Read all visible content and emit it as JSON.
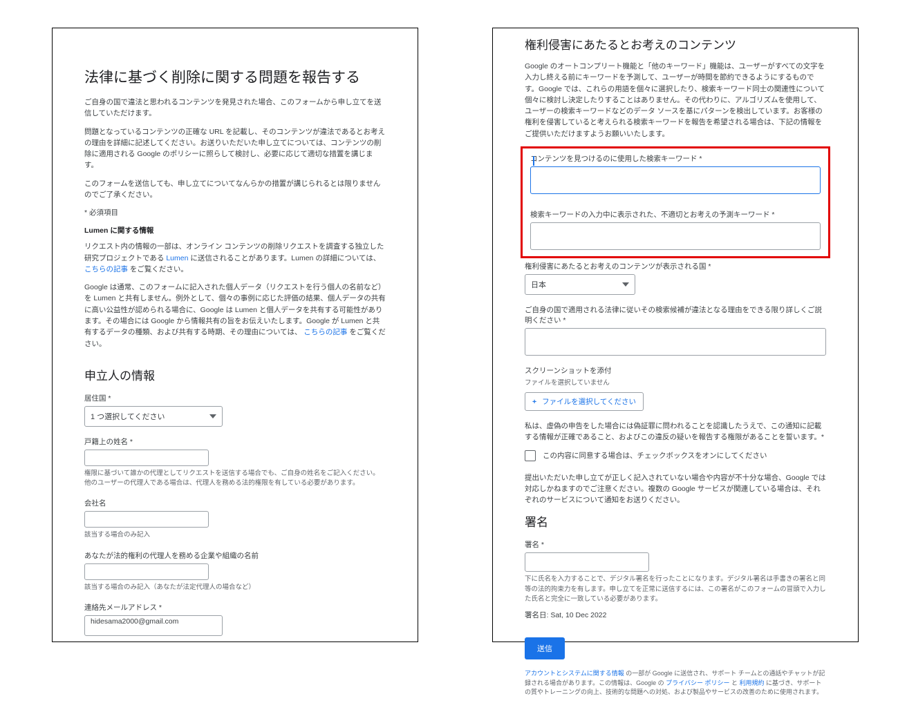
{
  "left": {
    "title": "法律に基づく削除に関する問題を報告する",
    "intro1": "ご自身の国で違法と思われるコンテンツを発見された場合、このフォームから申し立てを送信していただけます。",
    "intro2": "問題となっているコンテンツの正確な URL を記載し、そのコンテンツが違法であるとお考えの理由を詳細に記述してください。お送りいただいた申し立てについては、コンテンツの削除に適用される Google のポリシーに照らして検討し、必要に応じて適切な措置を講じます。",
    "intro3": "このフォームを送信しても、申し立てについてなんらかの措置が講じられるとは限りませんのでご了承ください。",
    "required_note": "* 必須項目",
    "lumen_heading": "Lumen に関する情報",
    "lumen1_a": "リクエスト内の情報の一部は、オンライン コンテンツの削除リクエストを調査する独立した研究プロジェクトである ",
    "lumen1_link": "Lumen",
    "lumen1_b": " に送信されることがあります。Lumen の詳細については、",
    "lumen1_link2": "こちらの記事",
    "lumen1_c": "をご覧ください。",
    "lumen2_a": "Google は通常、このフォームに記入された個人データ（リクエストを行う個人の名前など）を Lumen と共有しません。例外として、個々の事例に応じた評価の結果、個人データの共有に高い公益性が認められる場合に、Google は Lumen と個人データを共有する可能性があります。その場合には Google から情報共有の旨をお伝えいたします。Google が Lumen と共有するデータの種類、および共有する時期、その理由については、",
    "lumen2_link": "こちらの記事",
    "lumen2_b": "をご覧ください。",
    "section_applicant": "申立人の情報",
    "country_label": "居住国 *",
    "country_select": "1 つ選択してください",
    "legalname_label": "戸籍上の姓名 *",
    "legalname_hint": "権限に基づいて誰かの代理としてリクエストを送信する場合でも、ご自身の姓名をご記入ください。他のユーザーの代理人である場合は、代理人を務める法的権限を有している必要があります。",
    "company_label": "会社名",
    "company_hint": "該当する場合のみ記入",
    "agent_label": "あなたが法的権利の代理人を務める企業や組織の名前",
    "agent_hint": "該当する場合のみ記入（あなたが法定代理人の場合など）",
    "email_label": "連絡先メールアドレス *",
    "email_value": "hidesama2000@gmail.com"
  },
  "right": {
    "section_content": "権利侵害にあたるとお考えのコンテンツ",
    "autocomplete_desc": "Google のオートコンプリート機能と「他のキーワード」機能は、ユーザーがすべての文字を入力し終える前にキーワードを予測して、ユーザーが時間を節約できるようにするものです。Google では、これらの用語を個々に選択したり、検索キーワード同士の関連性について個々に検討し決定したりすることはありません。その代わりに、アルゴリズムを使用して、ユーザーの検索キーワードなどのデータ ソースを基にパターンを検出しています。お客様の権利を侵害していると考えられる検索キーワードを報告を希望される場合は、下記の情報をご提供いただけますようお願いいたします。",
    "kw_used_label": "コンテンツを見つけるのに使用した検索キーワード *",
    "kw_pred_label": "検索キーワードの入力中に表示された、不適切とお考えの予測キーワード *",
    "display_country_label": "権利侵害にあたるとお考えのコンテンツが表示される国 *",
    "display_country_value": "日本",
    "reason_label": "ご自身の国で適用される法律に従いその検索候補が違法となる理由をできる限り詳しくご説明ください *",
    "screenshot_label": "スクリーンショットを添付",
    "file_none": "ファイルを選択していません",
    "file_btn": "ファイルを選択してください",
    "ack_text": "私は、虚偽の申告をした場合には偽証罪に問われることを認識したうえで、この通知に記載する情報が正確であること、およびこの違反の疑いを報告する権限があることを誓います。*",
    "checkbox_text": "この内容に同意する場合は、チェックボックスをオンにしてください",
    "submit_note": "提出いただいた申し立てが正しく記入されていない場合や内容が不十分な場合、Google では対応しかねますのでご注意ください。複数の Google サービスが関連している場合は、それぞれのサービスについて通知をお送りください。",
    "sign_section": "署名",
    "sign_label": "署名 *",
    "sign_hint": "下に氏名を入力することで、デジタル署名を行ったことになります。デジタル署名は手書きの署名と同等の法的拘束力を有します。申し立てを正常に送信するには、この署名がこのフォームの冒頭で入力した氏名と完全に一致している必要があります。",
    "sign_date_label": "署名日: ",
    "sign_date_value": "Sat, 10 Dec 2022",
    "submit_btn": "送信",
    "footer_a": "アカウントとシステムに関する情報",
    "footer_b": "の一部が Google に送信され、サポート チームとの通話やチャットが記録される場合があります。この情報は、Google の",
    "footer_link1": "プライバシー ポリシー",
    "footer_c": "と",
    "footer_link2": "利用規約",
    "footer_d": "に基づき、サポートの質やトレーニングの向上、技術的な問題への対処、および製品やサービスの改善のために使用されます。"
  }
}
